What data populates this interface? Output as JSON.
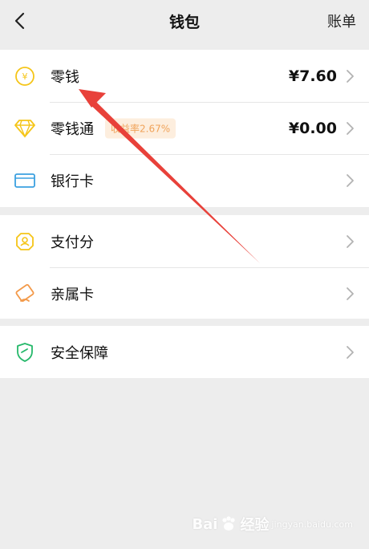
{
  "header": {
    "title": "钱包",
    "bill_label": "账单",
    "back_icon": "back-chevron-icon"
  },
  "wallet_group": [
    {
      "label": "零钱",
      "amount": "¥7.60",
      "icon": "yuan-coin-icon",
      "icon_color": "#f5c518"
    },
    {
      "label": "零钱通",
      "badge": "收益率2.67%",
      "amount": "¥0.00",
      "icon": "diamond-icon",
      "icon_color": "#f5c518"
    },
    {
      "label": "银行卡",
      "icon": "bank-card-icon",
      "icon_color": "#3ba0e0"
    }
  ],
  "service_group": [
    {
      "label": "支付分",
      "icon": "score-badge-icon",
      "icon_color": "#f5c518"
    },
    {
      "label": "亲属卡",
      "icon": "family-card-icon",
      "icon_color": "#f39a4a"
    }
  ],
  "security_group": [
    {
      "label": "安全保障",
      "icon": "shield-icon",
      "icon_color": "#25b86a"
    }
  ],
  "annotation": {
    "color": "#e8413a",
    "points_to": "零钱"
  },
  "watermark": {
    "brand": "Bai",
    "brand2": "经验",
    "sub": "jingyan.baidu.com"
  },
  "colors": {
    "background": "#ededed",
    "card": "#ffffff",
    "badge_bg": "#fdeede",
    "badge_text": "#f0a35a"
  }
}
